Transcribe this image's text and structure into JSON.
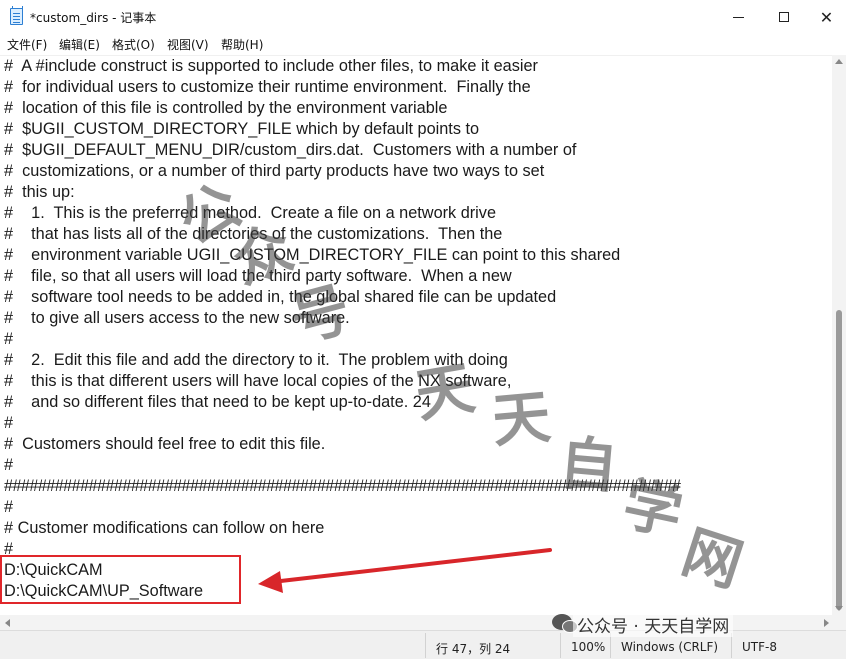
{
  "window": {
    "title": "*custom_dirs - 记事本",
    "minimize_glyph": "",
    "maximize_glyph": "",
    "close_glyph": "✕"
  },
  "menu": {
    "items": [
      "文件(F)",
      "编辑(E)",
      "格式(O)",
      "视图(V)",
      "帮助(H)"
    ]
  },
  "editor": {
    "lines": [
      "#  A #include construct is supported to include other files, to make it easier",
      "#  for individual users to customize their runtime environment.  Finally the",
      "#  location of this file is controlled by the environment variable",
      "#  $UGII_CUSTOM_DIRECTORY_FILE which by default points to",
      "#  $UGII_DEFAULT_MENU_DIR/custom_dirs.dat.  Customers with a number of",
      "#  customizations, or a number of third party products have two ways to set",
      "#  this up:",
      "#    1.  This is the preferred method.  Create a file on a network drive",
      "#    that has lists all of the directories of the customizations.  Then the",
      "#    environment variable UGII_CUSTOM_DIRECTORY_FILE can point to this shared",
      "#    file, so that all users will load the third party software.  When a new",
      "#    software tool needs to be added in, the global shared file can be updated",
      "#    to give all users access to the new software.",
      "#",
      "#    2.  Edit this file and add the directory to it.  The problem with doing",
      "#    this is that different users will have local copies of the NX software,",
      "#    and so different files that need to be kept up-to-date. 24",
      "#",
      "#  Customers should feel free to edit this file.",
      "#",
      "################################################################################",
      "#",
      "# Customer modifications can follow on here",
      "#",
      "D:\\QuickCAM",
      "D:\\QuickCAM\\UP_Software"
    ]
  },
  "status": {
    "position": "行 47，列 24",
    "zoom": "100%",
    "line_ending": "Windows (CRLF)",
    "encoding": "UTF-8"
  },
  "watermark": {
    "chars": [
      "公",
      "众",
      "号",
      "天",
      "天",
      "自",
      "学",
      "网"
    ],
    "footer": "公众号 · 天天自学网"
  },
  "colors": {
    "highlight": "#e0262a",
    "arrow": "#d8262a"
  }
}
